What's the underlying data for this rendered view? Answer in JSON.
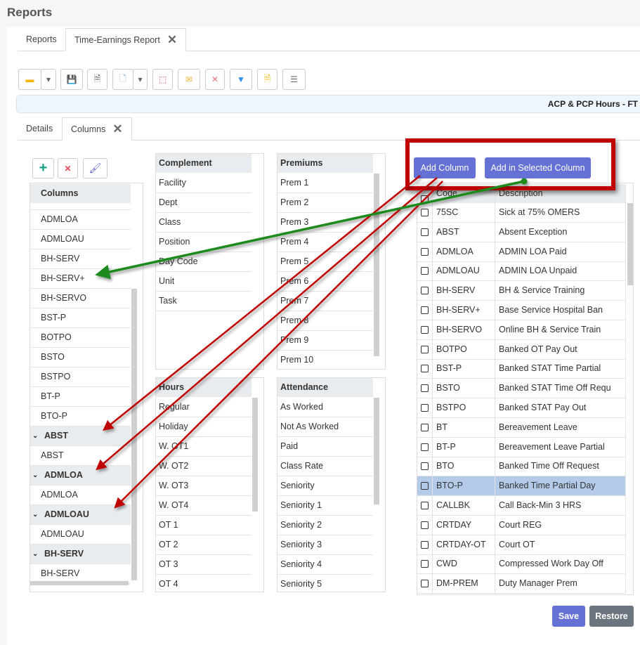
{
  "page_title": "Reports",
  "tabs": [
    {
      "label": "Reports"
    },
    {
      "label": "Time-Earnings Report",
      "closable": true
    }
  ],
  "toolbar": [
    "folder-icon",
    "dropdown-caret-icon",
    "save-icon",
    "document-icon",
    "new-document-icon",
    "dropdown-caret-icon",
    "pdf-icon",
    "email-icon",
    "delete-icon",
    "filter-icon",
    "notes-icon",
    "list-icon"
  ],
  "report_name": "ACP & PCP Hours - FT",
  "subtabs": [
    {
      "label": "Details"
    },
    {
      "label": "Columns",
      "closable": true
    }
  ],
  "columns_panel": {
    "header": "Columns",
    "rows": [
      {
        "t": ""
      },
      {
        "t": "ADMLOA"
      },
      {
        "t": "ADMLOAU"
      },
      {
        "t": "BH-SERV"
      },
      {
        "t": "BH-SERV+"
      },
      {
        "t": "BH-SERVO"
      },
      {
        "t": "BST-P"
      },
      {
        "t": "BOTPO"
      },
      {
        "t": "BSTO"
      },
      {
        "t": "BSTPO"
      },
      {
        "t": "BT-P"
      },
      {
        "t": "BTO-P"
      },
      {
        "t": "ABST",
        "group": true
      },
      {
        "t": "ABST"
      },
      {
        "t": "ADMLOA",
        "group": true
      },
      {
        "t": "ADMLOA"
      },
      {
        "t": "ADMLOAU",
        "group": true
      },
      {
        "t": "ADMLOAU"
      },
      {
        "t": "BH-SERV",
        "group": true
      },
      {
        "t": "BH-SERV"
      }
    ]
  },
  "complement": {
    "header": "Complement",
    "items": [
      "Facility",
      "Dept",
      "Class",
      "Position",
      "Day Code",
      "Unit",
      "Task"
    ]
  },
  "premiums": {
    "header": "Premiums",
    "items": [
      "Prem 1",
      "Prem 2",
      "Prem 3",
      "Prem 4",
      "Prem 5",
      "Prem 6",
      "Prem 7",
      "Prem 8",
      "Prem 9",
      "Prem 10"
    ]
  },
  "hours": {
    "header": "Hours",
    "items": [
      "Regular",
      "Holiday",
      "W. OT1",
      "W. OT2",
      "W. OT3",
      "W. OT4",
      "OT 1",
      "OT 2",
      "OT 3",
      "OT 4"
    ]
  },
  "attendance": {
    "header": "Attendance",
    "items": [
      "As Worked",
      "Not As Worked",
      "Paid",
      "Class Rate",
      "Seniority",
      "Seniority 1",
      "Seniority 2",
      "Seniority 3",
      "Seniority 4",
      "Seniority 5"
    ]
  },
  "buttons": {
    "add_column": "Add Column",
    "add_in_selected": "Add in Selected Column",
    "save": "Save",
    "restore": "Restore"
  },
  "codes_table": {
    "headers": [
      "Code",
      "Description"
    ],
    "selected": "BTO-P",
    "rows": [
      [
        "75SC",
        "Sick at 75% OMERS"
      ],
      [
        "ABST",
        "Absent Exception"
      ],
      [
        "ADMLOA",
        "ADMIN LOA Paid"
      ],
      [
        "ADMLOAU",
        "ADMIN LOA Unpaid"
      ],
      [
        "BH-SERV",
        "BH & Service Training"
      ],
      [
        "BH-SERV+",
        "Base Service Hospital Ban"
      ],
      [
        "BH-SERVO",
        "Online BH & Service Train"
      ],
      [
        "BOTPO",
        "Banked OT Pay Out"
      ],
      [
        "BST-P",
        "Banked STAT Time Partial"
      ],
      [
        "BSTO",
        "Banked STAT Time Off Requ"
      ],
      [
        "BSTPO",
        "Banked STAT Pay Out"
      ],
      [
        "BT",
        "Bereavement Leave"
      ],
      [
        "BT-P",
        "Bereavement Leave Partial"
      ],
      [
        "BTO",
        "Banked Time Off Request"
      ],
      [
        "BTO-P",
        "Banked Time Partial Day"
      ],
      [
        "CALLBK",
        "Call Back-Min 3 HRS"
      ],
      [
        "CRTDAY",
        "Court REG"
      ],
      [
        "CRTDAY-OT",
        "Court OT"
      ],
      [
        "CWD",
        "Compressed Work Day Off"
      ],
      [
        "DM-PREM",
        "Duty Manager Prem"
      ]
    ]
  },
  "colors": {
    "accent": "#6671d6",
    "annotation_box": "#c00000",
    "arrow_red": "#c00000",
    "arrow_green": "#1a8a1a",
    "selected_row": "#b3cbe8"
  }
}
